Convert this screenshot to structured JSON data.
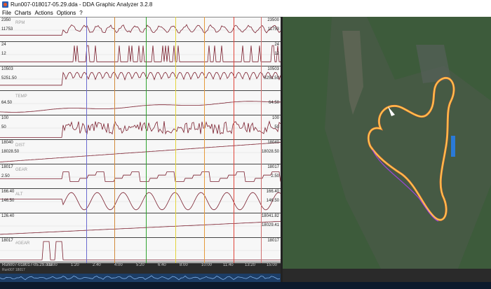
{
  "window": {
    "title": "Run007-018017-05.29.dda - DDA Graphic Analyzer 3.2.8"
  },
  "menu": {
    "items": [
      "File",
      "Charts",
      "Actions",
      "Options",
      "?"
    ]
  },
  "panels": [
    {
      "name": "RPM",
      "left_top": "2350",
      "left_mid": "11753",
      "right_top": "23500",
      "right_mid": "11753"
    },
    {
      "name": "",
      "left_top": "24",
      "left_mid": "12",
      "right_top": "24",
      "right_mid": "12"
    },
    {
      "name": "",
      "left_top": "10503",
      "left_mid": "5251.50",
      "right_top": "10503",
      "right_mid": "5251.50"
    },
    {
      "name": "TEMP",
      "left_top": "",
      "left_mid": "64.50",
      "right_top": "",
      "right_mid": "64.50"
    },
    {
      "name": "",
      "left_top": "100",
      "left_mid": "50",
      "right_top": "100",
      "right_mid": "50"
    },
    {
      "name": "DIST",
      "left_top": "18040",
      "left_mid": "18028.50",
      "right_top": "18040",
      "right_mid": "18028.50"
    },
    {
      "name": "GEAR",
      "left_top": "18017",
      "left_mid": "2.50",
      "right_top": "18017",
      "right_mid": "2.50"
    },
    {
      "name": "ALT",
      "left_top": "166.40",
      "left_mid": "146.50",
      "right_top": "166.40",
      "right_mid": "146.50"
    },
    {
      "name": "",
      "left_top": "126.40",
      "left_mid": "",
      "right_top": "18041.82",
      "right_mid": "18029.41"
    },
    {
      "name": "#GEAR",
      "left_top": "18017",
      "left_mid": "",
      "right_top": "18017",
      "right_mid": ""
    }
  ],
  "time_ticks": [
    "0:00",
    "1:20",
    "2:40",
    "4:00",
    "5:20",
    "6:40",
    "8:00",
    "10:00",
    "11:40",
    "13:20",
    "15:00"
  ],
  "status": {
    "file": "Run007-018017-05.29.dda",
    "sub": "Run007 18017"
  },
  "colors": {
    "trace": "#7a1f2e",
    "panel_bg": "#f7f7f7",
    "map_grass": "#3c5a3a",
    "track": "#e07840"
  }
}
